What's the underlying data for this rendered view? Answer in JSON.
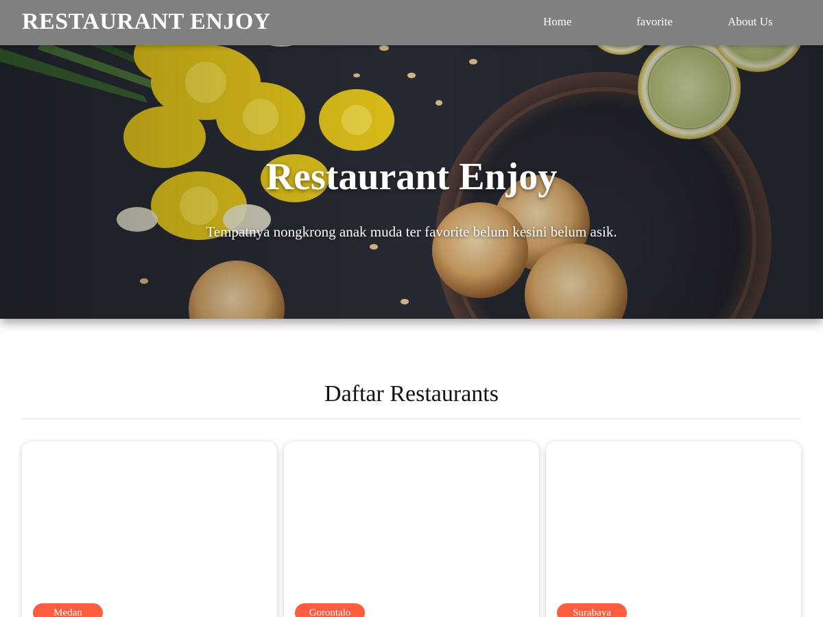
{
  "nav": {
    "brand": "RESTAURANT ENJOY",
    "items": [
      {
        "label": "Home"
      },
      {
        "label": "favorite"
      },
      {
        "label": "About Us"
      }
    ]
  },
  "hero": {
    "title": "Restaurant Enjoy",
    "tagline": "Tempatnya nongkrong anak muda ter favorite belum kesini belum asik."
  },
  "main": {
    "section_title": "Daftar Restaurants",
    "cards": [
      {
        "city": "Medan"
      },
      {
        "city": "Gorontalo"
      },
      {
        "city": "Surabaya"
      }
    ]
  },
  "colors": {
    "navbar": "#808080",
    "badge": "#fd5e3f",
    "hero_text": "#ffffff"
  }
}
